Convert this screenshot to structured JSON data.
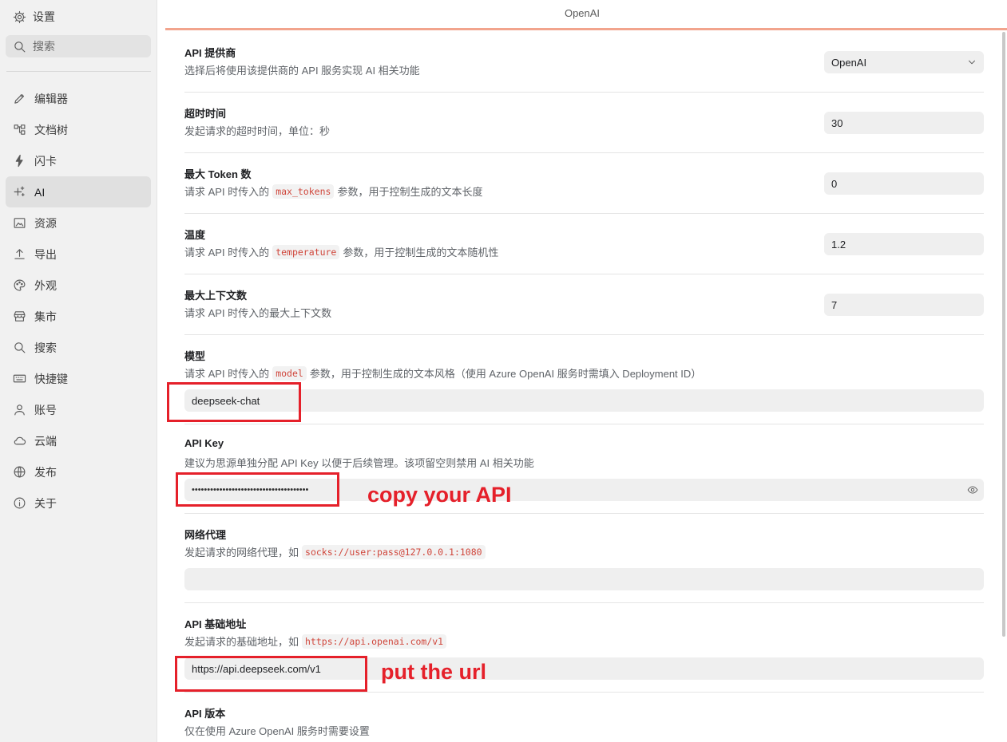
{
  "sidebar": {
    "title": "设置",
    "search_label": "搜索",
    "items": [
      {
        "label": "编辑器",
        "icon": "pencil-icon",
        "active": false
      },
      {
        "label": "文档树",
        "icon": "file-tree-icon",
        "active": false
      },
      {
        "label": "闪卡",
        "icon": "lightning-icon",
        "active": false
      },
      {
        "label": "AI",
        "icon": "sparkle-icon",
        "active": true
      },
      {
        "label": "资源",
        "icon": "image-icon",
        "active": false
      },
      {
        "label": "导出",
        "icon": "upload-icon",
        "active": false
      },
      {
        "label": "外观",
        "icon": "palette-icon",
        "active": false
      },
      {
        "label": "集市",
        "icon": "store-icon",
        "active": false
      },
      {
        "label": "搜索",
        "icon": "search-icon",
        "active": false
      },
      {
        "label": "快捷键",
        "icon": "keyboard-icon",
        "active": false
      },
      {
        "label": "账号",
        "icon": "user-icon",
        "active": false
      },
      {
        "label": "云端",
        "icon": "cloud-icon",
        "active": false
      },
      {
        "label": "发布",
        "icon": "globe-icon",
        "active": false
      },
      {
        "label": "关于",
        "icon": "info-icon",
        "active": false
      }
    ]
  },
  "main": {
    "tab_title": "OpenAI",
    "provider": {
      "title": "API 提供商",
      "desc": "选择后将使用该提供商的 API 服务实现 AI 相关功能",
      "value": "OpenAI"
    },
    "timeout": {
      "title": "超时时间",
      "desc": "发起请求的超时时间，单位：秒",
      "value": "30"
    },
    "max_tokens": {
      "title": "最大 Token 数",
      "desc_pre": "请求 API 时传入的",
      "code": "max_tokens",
      "desc_post": "参数，用于控制生成的文本长度",
      "value": "0"
    },
    "temperature": {
      "title": "温度",
      "desc_pre": "请求 API 时传入的",
      "code": "temperature",
      "desc_post": "参数，用于控制生成的文本随机性",
      "value": "1.2"
    },
    "max_context": {
      "title": "最大上下文数",
      "desc": "请求 API 时传入的最大上下文数",
      "value": "7"
    },
    "model": {
      "title": "模型",
      "desc_pre": "请求 API 时传入的",
      "code": "model",
      "desc_post": "参数，用于控制生成的文本风格（使用 Azure OpenAI 服务时需填入 Deployment ID）",
      "value": "deepseek-chat"
    },
    "api_key": {
      "title": "API Key",
      "desc": "建议为思源单独分配 API Key 以便于后续管理。该项留空则禁用 AI 相关功能",
      "value": "••••••••••••••••••••••••••••••••••••••"
    },
    "proxy": {
      "title": "网络代理",
      "desc_pre": "发起请求的网络代理，如",
      "code": "socks://user:pass@127.0.0.1:1080",
      "value": ""
    },
    "base_url": {
      "title": "API 基础地址",
      "desc_pre": "发起请求的基础地址，如",
      "code": "https://api.openai.com/v1",
      "value": "https://api.deepseek.com/v1"
    },
    "api_version": {
      "title": "API 版本",
      "desc": "仅在使用 Azure OpenAI 服务时需要设置"
    }
  },
  "annotations": {
    "api_key_note": "copy your API",
    "url_note": "put the url",
    "color": "#e5202a"
  },
  "colors": {
    "accent_line": "#f2a48d",
    "code_text": "#d0463b"
  }
}
